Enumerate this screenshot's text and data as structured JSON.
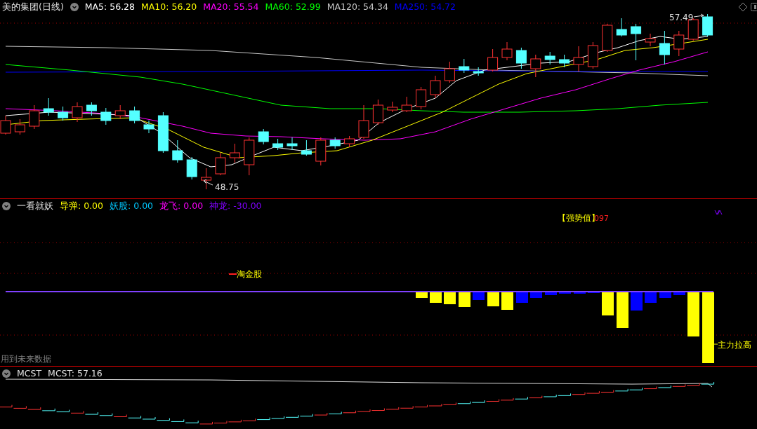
{
  "main_chart": {
    "stock_title": "美的集团(日线)",
    "indicators": [
      {
        "label": "MA5: 56.28",
        "color": "#ffffff"
      },
      {
        "label": "MA10: 56.20",
        "color": "#ffff00"
      },
      {
        "label": "MA20: 55.54",
        "color": "#ff00ff"
      },
      {
        "label": "MA60: 52.99",
        "color": "#00ff00"
      },
      {
        "label": "MA120: 54.34",
        "color": "#c8c8c8"
      },
      {
        "label": "MA250: 54.72",
        "color": "#0000ff"
      }
    ],
    "high_label": "57.49",
    "low_label": "48.75"
  },
  "indicator_panel": {
    "name": "一看就妖",
    "values": [
      {
        "label": "导弹: 0.00",
        "color": "#ffff00"
      },
      {
        "label": "妖股: 0.00",
        "color": "#00c8ff"
      },
      {
        "label": "龙飞: 0.00",
        "color": "#ff00ff"
      },
      {
        "label": "神龙: -30.00",
        "color": "#8000ff"
      }
    ],
    "tag_label": "淘金股",
    "strength_label": "【强势值】",
    "strength_value": "097",
    "rally_label": "主力拉高",
    "future_data_note": "用到未来数据"
  },
  "mcst_panel": {
    "name": "MCST",
    "value_label": "MCST: 57.16"
  }
}
